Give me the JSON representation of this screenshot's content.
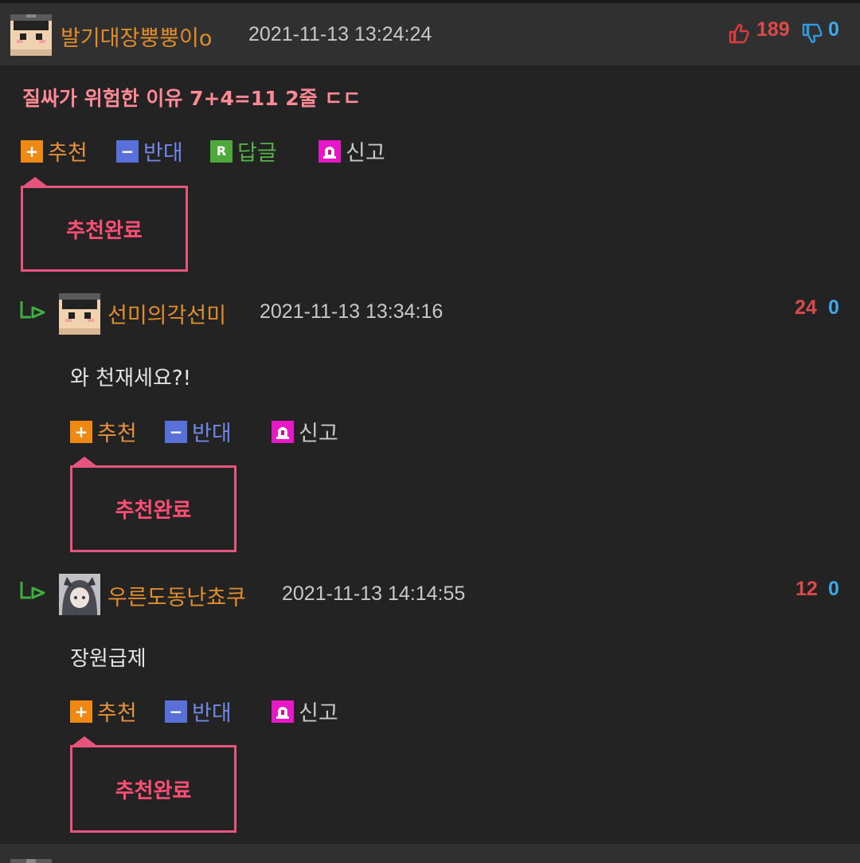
{
  "comment": {
    "nickname": "발기대장뿡뿡이o",
    "date": "2021-11-13 13:24:24",
    "up_count": "189",
    "down_count": "0",
    "text": "질싸가 위험한 이유 7+4=11 2줄 ㄷㄷ",
    "actions": {
      "recommend": "추천",
      "oppose": "반대",
      "reply": "답글",
      "report": "신고"
    },
    "toast": "추천완료"
  },
  "replies": [
    {
      "nickname": "선미의각선미",
      "date": "2021-11-13 13:34:16",
      "up_count": "24",
      "down_count": "0",
      "text": "와 천재세요?!",
      "actions": {
        "recommend": "추천",
        "oppose": "반대",
        "report": "신고"
      },
      "toast": "추천완료"
    },
    {
      "nickname": "우른도동난쵸쿠",
      "date": "2021-11-13 14:14:55",
      "up_count": "12",
      "down_count": "0",
      "text": "장원급제",
      "actions": {
        "recommend": "추천",
        "oppose": "반대",
        "report": "신고"
      },
      "toast": "추천완료"
    }
  ],
  "icons": {
    "plus": "+",
    "minus": "−",
    "reply_badge": "R",
    "report": "siren-icon",
    "thumb_up": "thumbs-up-icon",
    "thumb_down": "thumbs-down-icon",
    "reply_arrow": "reply-arrow-icon"
  },
  "colors": {
    "background": "#232323",
    "header": "#303030",
    "nickname": "#e08d2c",
    "up": "#dc4b4b",
    "down": "#3ea8e8",
    "title": "#ff8a96",
    "toast": "#e8557c"
  }
}
